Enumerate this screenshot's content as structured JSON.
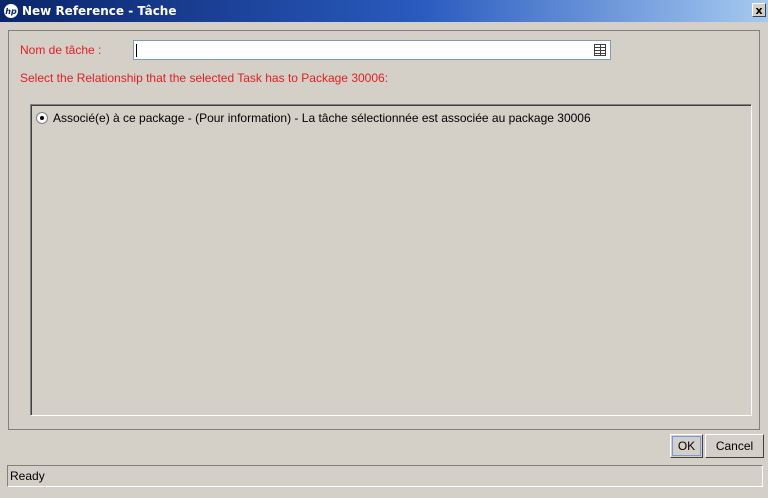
{
  "window": {
    "title": "New Reference - Tâche",
    "close_label": "x"
  },
  "form": {
    "task_label": "Nom de tâche :",
    "task_value": "",
    "picker_icon": "list-picker-icon",
    "instruction": "Select the Relationship that the selected Task has to Package 30006:"
  },
  "options": [
    {
      "label": "Associé(e) à ce package - (Pour information) - La tâche sélectionnée est associée au package 30006",
      "selected": true
    }
  ],
  "buttons": {
    "ok": "OK",
    "cancel": "Cancel"
  },
  "status": {
    "text": "Ready"
  }
}
